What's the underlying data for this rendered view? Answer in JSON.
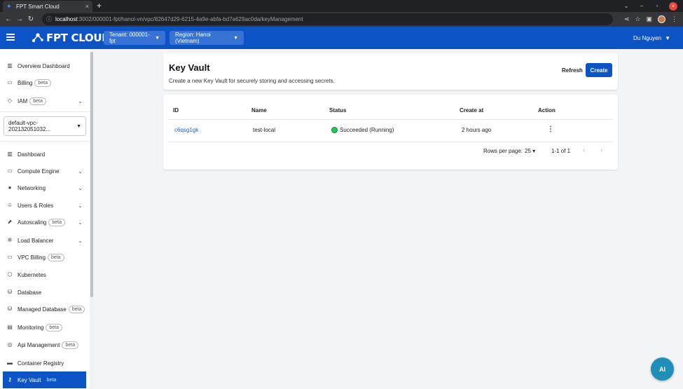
{
  "browser": {
    "tab_title": "FPT Smart Cloud",
    "tab_close": "×",
    "new_tab": "+",
    "url_host": "localhost",
    "url_path": ":3002/000001-fpt/hanoi-vn/vpc/82647d29-6215-4a9e-abfa-bd7a629ac0da/keyManagement"
  },
  "header": {
    "logo_text": "FPT CLOUD",
    "tenant_label": "Tenant: 000001-fpt",
    "region_label": "Region: Hanoi (Vietnam)",
    "user_name": "Du Nguyen"
  },
  "sidebar": {
    "top_items": [
      {
        "label": "Overview Dashboard",
        "icon": "bar-chart-icon"
      },
      {
        "label": "Billing",
        "badge": "beta",
        "icon": "receipt-icon"
      },
      {
        "label": "IAM",
        "badge": "beta",
        "icon": "shield-icon"
      }
    ],
    "vpc_selected": "default-vpc-202132051032...",
    "items": [
      {
        "label": "Dashboard",
        "icon": "bar-chart-icon"
      },
      {
        "label": "Compute Engine",
        "icon": "monitor-icon"
      },
      {
        "label": "Networking",
        "icon": "globe-icon"
      },
      {
        "label": "Users & Roles",
        "icon": "users-icon"
      },
      {
        "label": "Autoscaling",
        "badge": "beta",
        "icon": "autoscaling-icon"
      },
      {
        "label": "Load Balancer",
        "icon": "load-balancer-icon"
      },
      {
        "label": "VPC Billing",
        "badge": "beta",
        "icon": "receipt-icon"
      },
      {
        "label": "Kubernetes",
        "icon": "cube-icon"
      },
      {
        "label": "Database",
        "icon": "database-icon"
      },
      {
        "label": "Managed Database",
        "badge": "beta",
        "icon": "database-icon"
      },
      {
        "label": "Monitoring",
        "badge": "beta",
        "icon": "monitoring-icon"
      },
      {
        "label": "Api Management",
        "badge": "beta",
        "icon": "api-icon"
      },
      {
        "label": "Container Registry",
        "icon": "container-icon"
      },
      {
        "label": "Key Vault",
        "badge": "beta",
        "icon": "key-icon"
      }
    ]
  },
  "page": {
    "title": "Key Vault",
    "subtitle": "Create a new Key Vault for securely storing and accessing secrets.",
    "refresh_label": "Refresh",
    "create_label": "Create"
  },
  "table": {
    "columns": [
      "ID",
      "Name",
      "Status",
      "Create at",
      "Action"
    ],
    "rows": [
      {
        "id": "c6qsg1gk",
        "name": "test-local",
        "status": "Succeeded (Running)",
        "created": "2 hours ago"
      }
    ],
    "rows_per_page_label": "Rows per page:",
    "rows_per_page": "25",
    "range": "1-1 of 1"
  },
  "ai_button": "AI",
  "colors": {
    "primary": "#0c54c6",
    "success": "#22c55e"
  }
}
